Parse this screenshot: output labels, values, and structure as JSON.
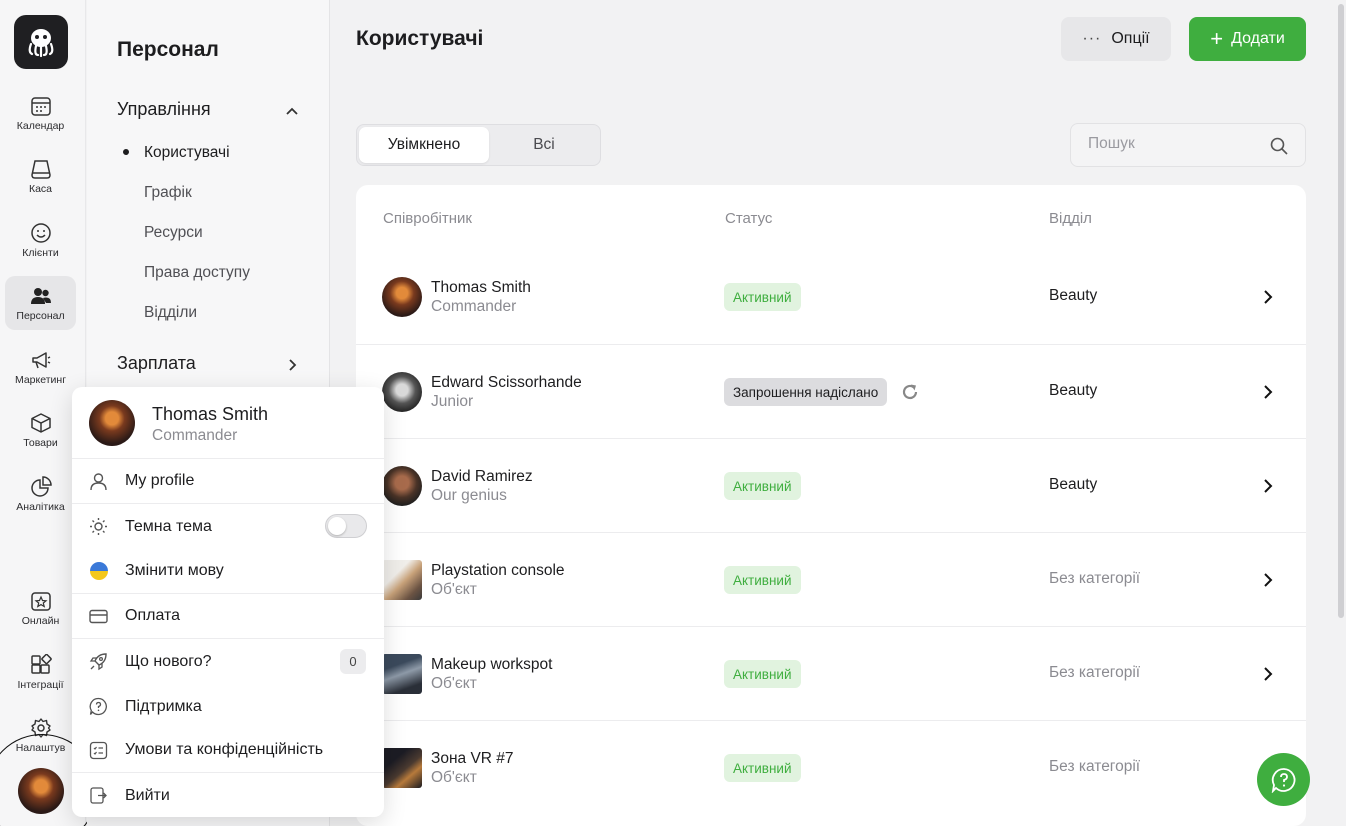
{
  "rail": {
    "items": [
      {
        "label": "Календар",
        "icon": "calendar-icon"
      },
      {
        "label": "Каса",
        "icon": "cashbox-icon"
      },
      {
        "label": "Клієнти",
        "icon": "smile-icon"
      },
      {
        "label": "Персонал",
        "icon": "users-icon",
        "active": true
      },
      {
        "label": "Маркетинг",
        "icon": "megaphone-icon"
      },
      {
        "label": "Товари",
        "icon": "box-icon"
      },
      {
        "label": "Аналітика",
        "icon": "pie-chart-icon"
      },
      {
        "label": "Онлайн",
        "icon": "star-calendar-icon"
      },
      {
        "label": "Інтеграції",
        "icon": "integrations-icon"
      },
      {
        "label": "Налаштув",
        "icon": "gear-icon"
      }
    ]
  },
  "section": {
    "title": "Персонал",
    "group1": "Управління",
    "subitems": [
      "Користувачі",
      "Графік",
      "Ресурси",
      "Права доступу",
      "Відділи"
    ],
    "group2": "Зарплата"
  },
  "main": {
    "title": "Користувачі",
    "options_label": "Опції",
    "add_label": "Додати",
    "tabs": [
      "Увімкнено",
      "Всі"
    ],
    "search_placeholder": "Пошук",
    "columns": [
      "Співробітник",
      "Статус",
      "Відділ"
    ],
    "rows": [
      {
        "name": "Thomas Smith",
        "role": "Commander",
        "status": "Активний",
        "dept": "Beauty"
      },
      {
        "name": "Edward Scissorhande",
        "role": "Junior",
        "status": "Запрошення надіслано",
        "dept": "Beauty"
      },
      {
        "name": "David Ramirez",
        "role": "Our genius",
        "status": "Активний",
        "dept": "Beauty"
      },
      {
        "name": "Playstation console",
        "role": "Об'єкт",
        "status": "Активний",
        "dept": "Без категорії"
      },
      {
        "name": "Makeup workspot",
        "role": "Об'єкт",
        "status": "Активний",
        "dept": "Без категорії"
      },
      {
        "name": "Зона VR #7",
        "role": "Об'єкт",
        "status": "Активний",
        "dept": "Без категорії"
      }
    ]
  },
  "menu": {
    "user_name": "Thomas Smith",
    "user_role": "Commander",
    "items": [
      "My profile",
      "Темна тема",
      "Змінити мову",
      "Оплата",
      "Що нового?",
      "Підтримка",
      "Умови та конфіденційність",
      "Вийти"
    ],
    "whats_new_count": "0"
  },
  "colors": {
    "accent": "#3fae3f",
    "badge_bg": "#e1f3df"
  }
}
